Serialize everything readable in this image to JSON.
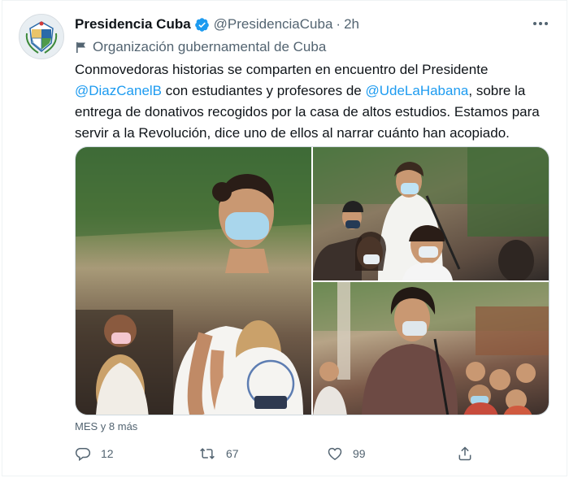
{
  "tweet": {
    "display_name": "Presidencia Cuba",
    "handle": "@PresidenciaCuba",
    "separator": "·",
    "time": "2h",
    "label": "Organización gubernamental de Cuba",
    "text": {
      "line1": "Conmovedoras historias se comparten en encuentro del Presidente",
      "mention1": "@DiazCanelB",
      "line2_mid": " con estudiantes y profesores de ",
      "mention2": "@UdeLaHabana",
      "line2_end": ", sobre la",
      "line3": "entrega de donativos recogidos por la casa de altos estudios. Estamos para",
      "line4": "servir a la Revolución, dice uno de ellos al narrar cuánto han acopiado."
    },
    "media_caption": "MES y 8 más",
    "counts": {
      "replies": "12",
      "retweets": "67",
      "likes": "99"
    }
  },
  "colors": {
    "accent": "#1d9bf0",
    "muted": "#536471",
    "text": "#0f1419",
    "border": "#cfd9de"
  },
  "icons": [
    "verified-badge-icon",
    "flag-icon",
    "more-icon",
    "reply-icon",
    "retweet-icon",
    "like-icon",
    "share-icon"
  ]
}
